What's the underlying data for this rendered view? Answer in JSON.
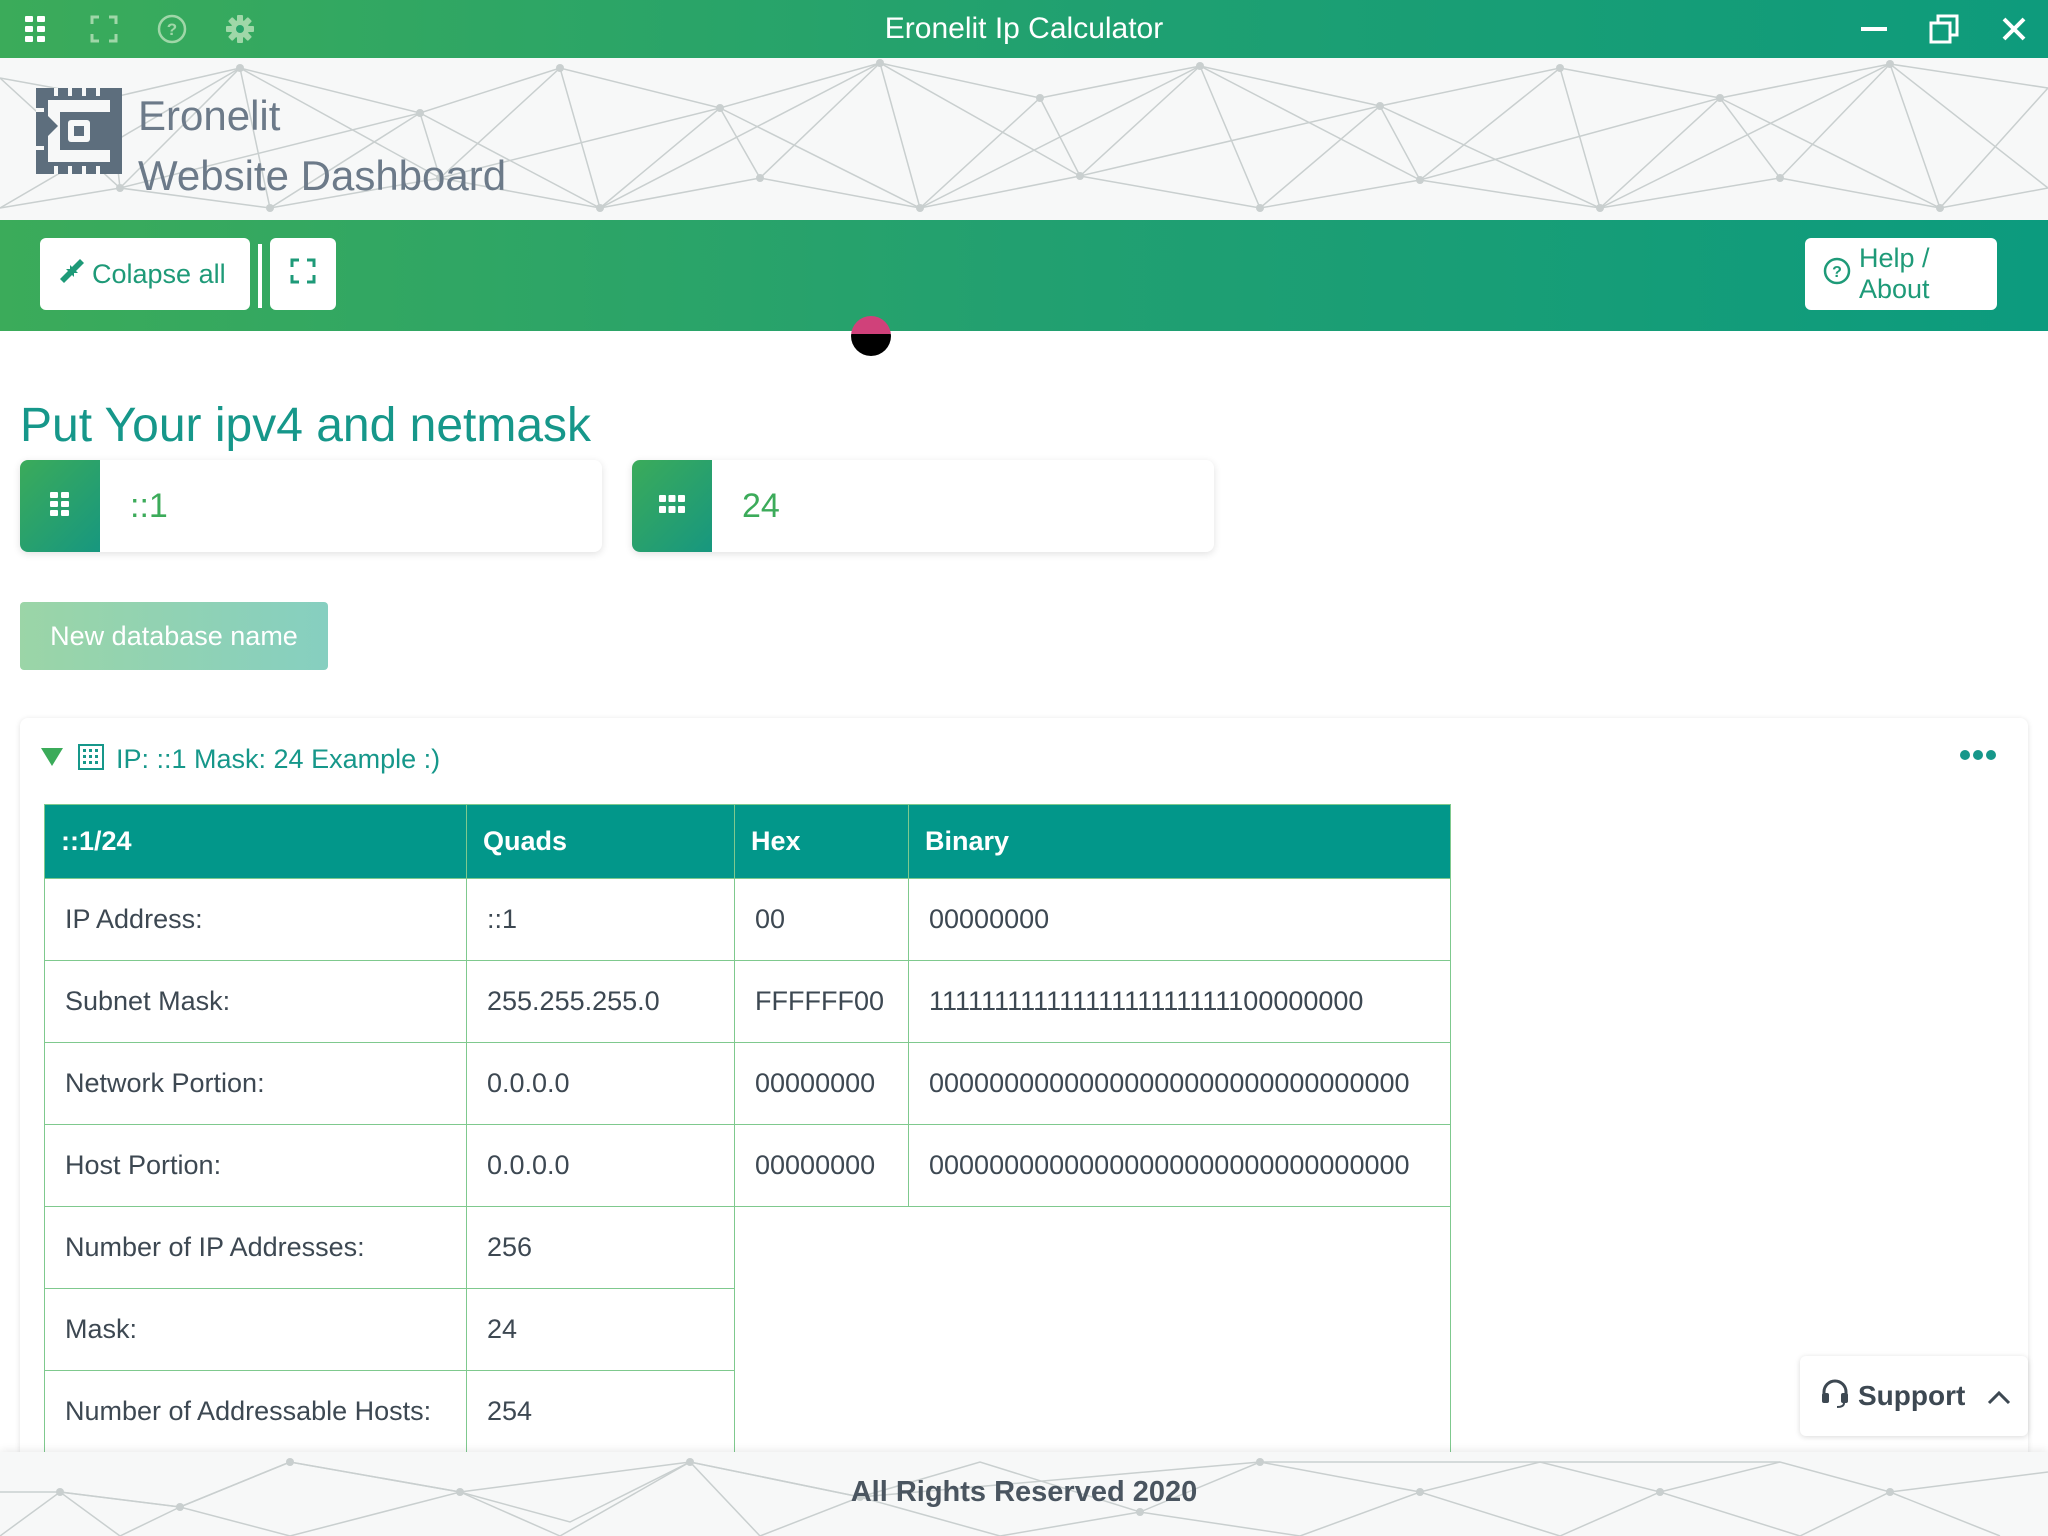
{
  "window": {
    "title": "Eronelit Ip Calculator"
  },
  "header": {
    "brand_line1": "Eronelit",
    "brand_line2": "Website Dashboard"
  },
  "toolbar": {
    "collapse_label": "Colapse all",
    "help_label": "Help / About"
  },
  "main": {
    "heading": "Put Your ipv4 and netmask",
    "ip_input_value": "::1",
    "mask_input_value": "24",
    "new_db_label": "New database name"
  },
  "card": {
    "title": "IP: ::1 Mask: 24 Example :)",
    "table": {
      "headers": [
        "::1/24",
        "Quads",
        "Hex",
        "Binary"
      ],
      "rows": [
        [
          "IP Address:",
          "::1",
          "00",
          "00000000"
        ],
        [
          "Subnet Mask:",
          "255.255.255.0",
          "FFFFFF00",
          "11111111111111111111111100000000"
        ],
        [
          "Network Portion:",
          "0.0.0.0",
          "00000000",
          "00000000000000000000000000000000"
        ],
        [
          "Host Portion:",
          "0.0.0.0",
          "00000000",
          "00000000000000000000000000000000"
        ],
        [
          "Number of IP Addresses:",
          "256"
        ],
        [
          "Mask:",
          "24"
        ],
        [
          "Number of Addressable Hosts:",
          "254"
        ]
      ]
    }
  },
  "support": {
    "label": "Support"
  },
  "footer": {
    "text": "All Rights Reserved 2020"
  },
  "colors": {
    "accent": "#16978a",
    "green": "#3bab5a",
    "table_header": "#02978a"
  }
}
